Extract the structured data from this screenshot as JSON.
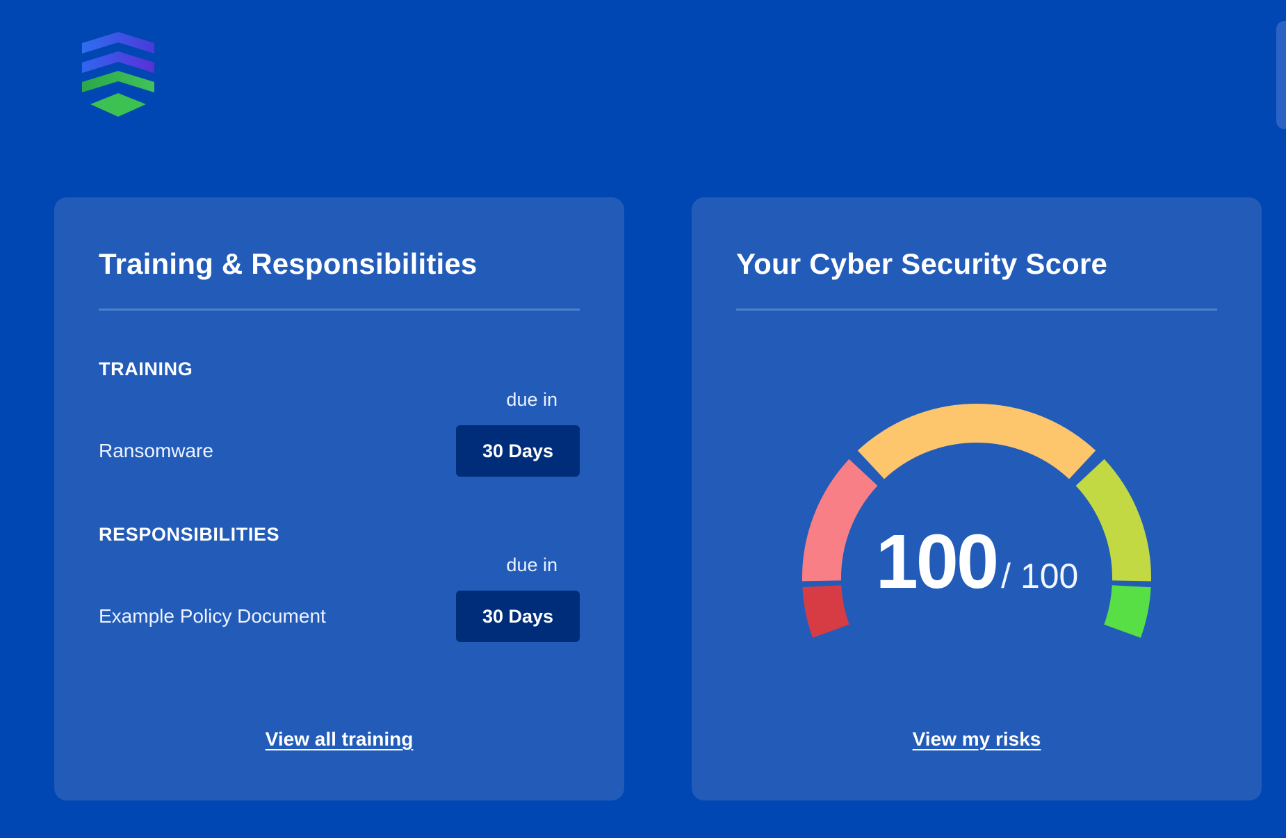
{
  "colors": {
    "background": "#0047b3",
    "card": "#225cb8",
    "badge": "#002d7a",
    "gauge_segments": [
      "#d73c44",
      "#f97f86",
      "#fdc56c",
      "#c2d943",
      "#58df46"
    ]
  },
  "logo": {
    "icon": "stacked-chevrons-logo"
  },
  "training_card": {
    "title": "Training & Responsibilities",
    "training_heading": "TRAINING",
    "training_items": [
      {
        "name": "Ransomware",
        "due_label": "due in",
        "due_value": "30 Days"
      }
    ],
    "responsibilities_heading": "RESPONSIBILITIES",
    "responsibility_items": [
      {
        "name": "Example Policy Document",
        "due_label": "due in",
        "due_value": "30 Days"
      }
    ],
    "link": "View all training"
  },
  "score_card": {
    "title": "Your Cyber Security Score",
    "score": "100",
    "score_max": "/ 100",
    "score_fraction": 1.0,
    "link": "View my risks"
  }
}
